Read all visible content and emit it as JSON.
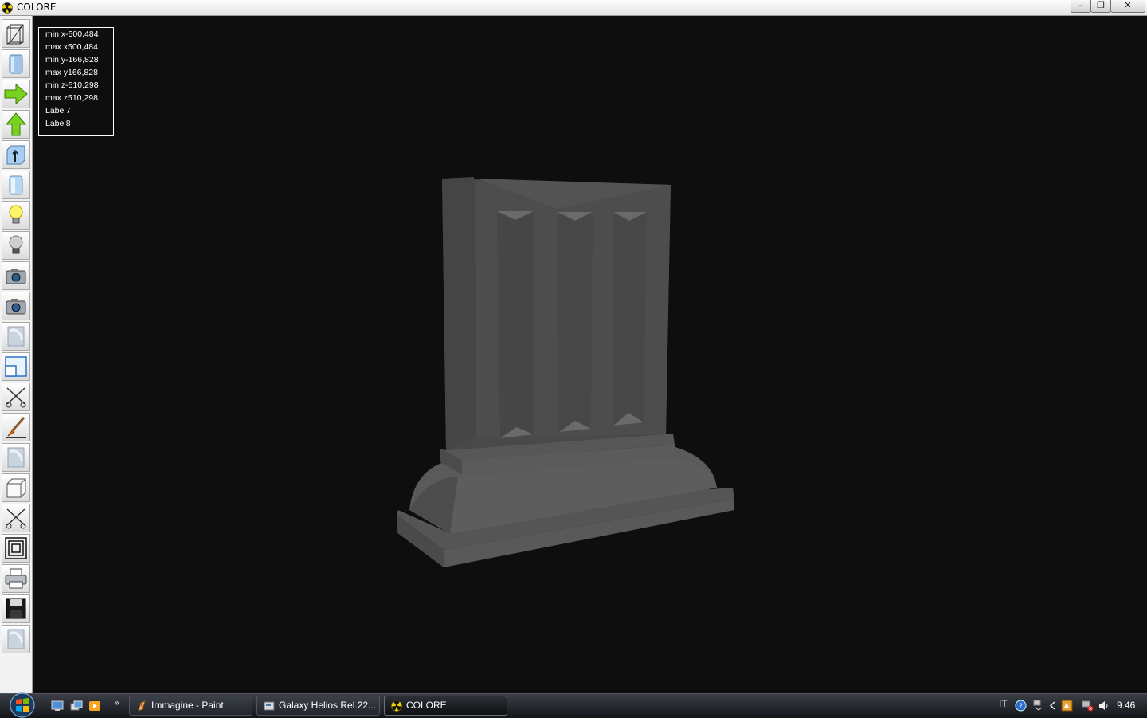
{
  "window": {
    "title": "COLORE",
    "icon": "radiation-icon",
    "controls": {
      "minimize": "–",
      "maximize": "❐",
      "close": "✕"
    }
  },
  "toolbar": {
    "tools": [
      {
        "id": "wireframe",
        "icon": "wireframe-cube-icon"
      },
      {
        "id": "solid",
        "icon": "solid-cylinder-icon"
      },
      {
        "id": "rotate-right",
        "icon": "green-arrow-right-icon"
      },
      {
        "id": "rotate-up",
        "icon": "green-arrow-up-icon"
      },
      {
        "id": "box-info",
        "icon": "info-box-icon"
      },
      {
        "id": "shade",
        "icon": "shade-cylinder-icon"
      },
      {
        "id": "light-on",
        "icon": "lightbulb-on-icon"
      },
      {
        "id": "light-off",
        "icon": "lightbulb-off-icon"
      },
      {
        "id": "camera-1",
        "icon": "camera-icon"
      },
      {
        "id": "camera-2",
        "icon": "camera-icon"
      },
      {
        "id": "texture-1",
        "icon": "texture-icon"
      },
      {
        "id": "window-view",
        "icon": "window-view-icon"
      },
      {
        "id": "cut-1",
        "icon": "scissors-icon"
      },
      {
        "id": "paint",
        "icon": "paintbrush-icon"
      },
      {
        "id": "texture-2",
        "icon": "texture-icon"
      },
      {
        "id": "cube",
        "icon": "cube-icon"
      },
      {
        "id": "cut-2",
        "icon": "scissors-icon"
      },
      {
        "id": "frames",
        "icon": "nested-squares-icon"
      },
      {
        "id": "print",
        "icon": "printer-icon"
      },
      {
        "id": "save",
        "icon": "floppy-disk-icon"
      },
      {
        "id": "texture-3",
        "icon": "texture-icon"
      }
    ]
  },
  "info_panel": {
    "lines": [
      "min x-500,484",
      "max x500,484",
      "min y-166,828",
      "max y166,828",
      "min z-510,298",
      "max z510,298",
      "Label7",
      "Label8"
    ]
  },
  "viewport": {
    "background": "#0e0e0e",
    "model_color": "#4f4f4f"
  },
  "taskbar": {
    "quick_launch_more": "»",
    "tasks": [
      {
        "label": "Immagine - Paint",
        "icon": "paint-icon",
        "active": false
      },
      {
        "label": "Galaxy Helios  Rel.22...",
        "icon": "galaxy-icon",
        "active": false
      },
      {
        "label": "COLORE",
        "icon": "radiation-icon",
        "active": true
      }
    ],
    "tray": {
      "language": "IT",
      "icons": [
        "help-icon",
        "network-icon",
        "chevron-left-icon",
        "security-icon",
        "network-error-icon",
        "volume-icon"
      ],
      "clock": "9.46"
    }
  }
}
